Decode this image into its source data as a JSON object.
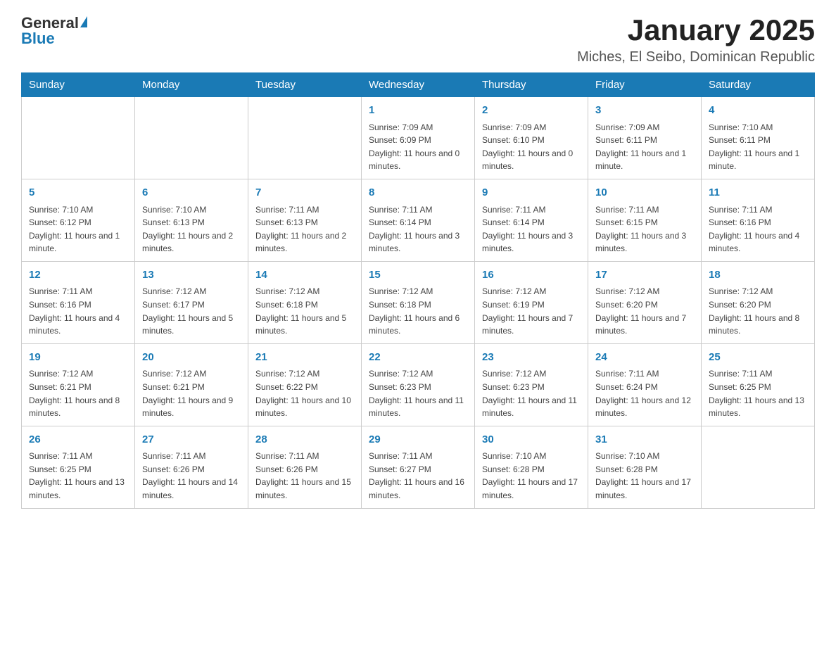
{
  "header": {
    "logo": {
      "general": "General",
      "blue": "Blue"
    },
    "title": "January 2025",
    "location": "Miches, El Seibo, Dominican Republic"
  },
  "days_of_week": [
    "Sunday",
    "Monday",
    "Tuesday",
    "Wednesday",
    "Thursday",
    "Friday",
    "Saturday"
  ],
  "weeks": [
    [
      {
        "day": "",
        "info": ""
      },
      {
        "day": "",
        "info": ""
      },
      {
        "day": "",
        "info": ""
      },
      {
        "day": "1",
        "info": "Sunrise: 7:09 AM\nSunset: 6:09 PM\nDaylight: 11 hours and 0 minutes."
      },
      {
        "day": "2",
        "info": "Sunrise: 7:09 AM\nSunset: 6:10 PM\nDaylight: 11 hours and 0 minutes."
      },
      {
        "day": "3",
        "info": "Sunrise: 7:09 AM\nSunset: 6:11 PM\nDaylight: 11 hours and 1 minute."
      },
      {
        "day": "4",
        "info": "Sunrise: 7:10 AM\nSunset: 6:11 PM\nDaylight: 11 hours and 1 minute."
      }
    ],
    [
      {
        "day": "5",
        "info": "Sunrise: 7:10 AM\nSunset: 6:12 PM\nDaylight: 11 hours and 1 minute."
      },
      {
        "day": "6",
        "info": "Sunrise: 7:10 AM\nSunset: 6:13 PM\nDaylight: 11 hours and 2 minutes."
      },
      {
        "day": "7",
        "info": "Sunrise: 7:11 AM\nSunset: 6:13 PM\nDaylight: 11 hours and 2 minutes."
      },
      {
        "day": "8",
        "info": "Sunrise: 7:11 AM\nSunset: 6:14 PM\nDaylight: 11 hours and 3 minutes."
      },
      {
        "day": "9",
        "info": "Sunrise: 7:11 AM\nSunset: 6:14 PM\nDaylight: 11 hours and 3 minutes."
      },
      {
        "day": "10",
        "info": "Sunrise: 7:11 AM\nSunset: 6:15 PM\nDaylight: 11 hours and 3 minutes."
      },
      {
        "day": "11",
        "info": "Sunrise: 7:11 AM\nSunset: 6:16 PM\nDaylight: 11 hours and 4 minutes."
      }
    ],
    [
      {
        "day": "12",
        "info": "Sunrise: 7:11 AM\nSunset: 6:16 PM\nDaylight: 11 hours and 4 minutes."
      },
      {
        "day": "13",
        "info": "Sunrise: 7:12 AM\nSunset: 6:17 PM\nDaylight: 11 hours and 5 minutes."
      },
      {
        "day": "14",
        "info": "Sunrise: 7:12 AM\nSunset: 6:18 PM\nDaylight: 11 hours and 5 minutes."
      },
      {
        "day": "15",
        "info": "Sunrise: 7:12 AM\nSunset: 6:18 PM\nDaylight: 11 hours and 6 minutes."
      },
      {
        "day": "16",
        "info": "Sunrise: 7:12 AM\nSunset: 6:19 PM\nDaylight: 11 hours and 7 minutes."
      },
      {
        "day": "17",
        "info": "Sunrise: 7:12 AM\nSunset: 6:20 PM\nDaylight: 11 hours and 7 minutes."
      },
      {
        "day": "18",
        "info": "Sunrise: 7:12 AM\nSunset: 6:20 PM\nDaylight: 11 hours and 8 minutes."
      }
    ],
    [
      {
        "day": "19",
        "info": "Sunrise: 7:12 AM\nSunset: 6:21 PM\nDaylight: 11 hours and 8 minutes."
      },
      {
        "day": "20",
        "info": "Sunrise: 7:12 AM\nSunset: 6:21 PM\nDaylight: 11 hours and 9 minutes."
      },
      {
        "day": "21",
        "info": "Sunrise: 7:12 AM\nSunset: 6:22 PM\nDaylight: 11 hours and 10 minutes."
      },
      {
        "day": "22",
        "info": "Sunrise: 7:12 AM\nSunset: 6:23 PM\nDaylight: 11 hours and 11 minutes."
      },
      {
        "day": "23",
        "info": "Sunrise: 7:12 AM\nSunset: 6:23 PM\nDaylight: 11 hours and 11 minutes."
      },
      {
        "day": "24",
        "info": "Sunrise: 7:11 AM\nSunset: 6:24 PM\nDaylight: 11 hours and 12 minutes."
      },
      {
        "day": "25",
        "info": "Sunrise: 7:11 AM\nSunset: 6:25 PM\nDaylight: 11 hours and 13 minutes."
      }
    ],
    [
      {
        "day": "26",
        "info": "Sunrise: 7:11 AM\nSunset: 6:25 PM\nDaylight: 11 hours and 13 minutes."
      },
      {
        "day": "27",
        "info": "Sunrise: 7:11 AM\nSunset: 6:26 PM\nDaylight: 11 hours and 14 minutes."
      },
      {
        "day": "28",
        "info": "Sunrise: 7:11 AM\nSunset: 6:26 PM\nDaylight: 11 hours and 15 minutes."
      },
      {
        "day": "29",
        "info": "Sunrise: 7:11 AM\nSunset: 6:27 PM\nDaylight: 11 hours and 16 minutes."
      },
      {
        "day": "30",
        "info": "Sunrise: 7:10 AM\nSunset: 6:28 PM\nDaylight: 11 hours and 17 minutes."
      },
      {
        "day": "31",
        "info": "Sunrise: 7:10 AM\nSunset: 6:28 PM\nDaylight: 11 hours and 17 minutes."
      },
      {
        "day": "",
        "info": ""
      }
    ]
  ]
}
